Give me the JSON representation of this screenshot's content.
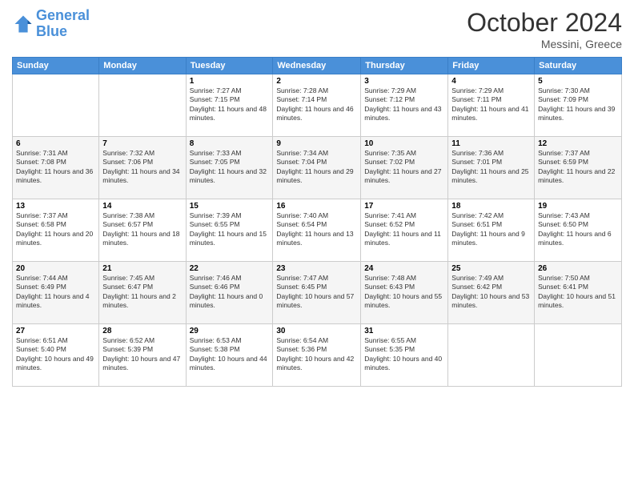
{
  "header": {
    "logo": {
      "line1": "General",
      "line2": "Blue"
    },
    "title": "October 2024",
    "location": "Messini, Greece"
  },
  "days_of_week": [
    "Sunday",
    "Monday",
    "Tuesday",
    "Wednesday",
    "Thursday",
    "Friday",
    "Saturday"
  ],
  "weeks": [
    [
      {
        "day": "",
        "info": ""
      },
      {
        "day": "",
        "info": ""
      },
      {
        "day": "1",
        "info": "Sunrise: 7:27 AM\nSunset: 7:15 PM\nDaylight: 11 hours and 48 minutes."
      },
      {
        "day": "2",
        "info": "Sunrise: 7:28 AM\nSunset: 7:14 PM\nDaylight: 11 hours and 46 minutes."
      },
      {
        "day": "3",
        "info": "Sunrise: 7:29 AM\nSunset: 7:12 PM\nDaylight: 11 hours and 43 minutes."
      },
      {
        "day": "4",
        "info": "Sunrise: 7:29 AM\nSunset: 7:11 PM\nDaylight: 11 hours and 41 minutes."
      },
      {
        "day": "5",
        "info": "Sunrise: 7:30 AM\nSunset: 7:09 PM\nDaylight: 11 hours and 39 minutes."
      }
    ],
    [
      {
        "day": "6",
        "info": "Sunrise: 7:31 AM\nSunset: 7:08 PM\nDaylight: 11 hours and 36 minutes."
      },
      {
        "day": "7",
        "info": "Sunrise: 7:32 AM\nSunset: 7:06 PM\nDaylight: 11 hours and 34 minutes."
      },
      {
        "day": "8",
        "info": "Sunrise: 7:33 AM\nSunset: 7:05 PM\nDaylight: 11 hours and 32 minutes."
      },
      {
        "day": "9",
        "info": "Sunrise: 7:34 AM\nSunset: 7:04 PM\nDaylight: 11 hours and 29 minutes."
      },
      {
        "day": "10",
        "info": "Sunrise: 7:35 AM\nSunset: 7:02 PM\nDaylight: 11 hours and 27 minutes."
      },
      {
        "day": "11",
        "info": "Sunrise: 7:36 AM\nSunset: 7:01 PM\nDaylight: 11 hours and 25 minutes."
      },
      {
        "day": "12",
        "info": "Sunrise: 7:37 AM\nSunset: 6:59 PM\nDaylight: 11 hours and 22 minutes."
      }
    ],
    [
      {
        "day": "13",
        "info": "Sunrise: 7:37 AM\nSunset: 6:58 PM\nDaylight: 11 hours and 20 minutes."
      },
      {
        "day": "14",
        "info": "Sunrise: 7:38 AM\nSunset: 6:57 PM\nDaylight: 11 hours and 18 minutes."
      },
      {
        "day": "15",
        "info": "Sunrise: 7:39 AM\nSunset: 6:55 PM\nDaylight: 11 hours and 15 minutes."
      },
      {
        "day": "16",
        "info": "Sunrise: 7:40 AM\nSunset: 6:54 PM\nDaylight: 11 hours and 13 minutes."
      },
      {
        "day": "17",
        "info": "Sunrise: 7:41 AM\nSunset: 6:52 PM\nDaylight: 11 hours and 11 minutes."
      },
      {
        "day": "18",
        "info": "Sunrise: 7:42 AM\nSunset: 6:51 PM\nDaylight: 11 hours and 9 minutes."
      },
      {
        "day": "19",
        "info": "Sunrise: 7:43 AM\nSunset: 6:50 PM\nDaylight: 11 hours and 6 minutes."
      }
    ],
    [
      {
        "day": "20",
        "info": "Sunrise: 7:44 AM\nSunset: 6:49 PM\nDaylight: 11 hours and 4 minutes."
      },
      {
        "day": "21",
        "info": "Sunrise: 7:45 AM\nSunset: 6:47 PM\nDaylight: 11 hours and 2 minutes."
      },
      {
        "day": "22",
        "info": "Sunrise: 7:46 AM\nSunset: 6:46 PM\nDaylight: 11 hours and 0 minutes."
      },
      {
        "day": "23",
        "info": "Sunrise: 7:47 AM\nSunset: 6:45 PM\nDaylight: 10 hours and 57 minutes."
      },
      {
        "day": "24",
        "info": "Sunrise: 7:48 AM\nSunset: 6:43 PM\nDaylight: 10 hours and 55 minutes."
      },
      {
        "day": "25",
        "info": "Sunrise: 7:49 AM\nSunset: 6:42 PM\nDaylight: 10 hours and 53 minutes."
      },
      {
        "day": "26",
        "info": "Sunrise: 7:50 AM\nSunset: 6:41 PM\nDaylight: 10 hours and 51 minutes."
      }
    ],
    [
      {
        "day": "27",
        "info": "Sunrise: 6:51 AM\nSunset: 5:40 PM\nDaylight: 10 hours and 49 minutes."
      },
      {
        "day": "28",
        "info": "Sunrise: 6:52 AM\nSunset: 5:39 PM\nDaylight: 10 hours and 47 minutes."
      },
      {
        "day": "29",
        "info": "Sunrise: 6:53 AM\nSunset: 5:38 PM\nDaylight: 10 hours and 44 minutes."
      },
      {
        "day": "30",
        "info": "Sunrise: 6:54 AM\nSunset: 5:36 PM\nDaylight: 10 hours and 42 minutes."
      },
      {
        "day": "31",
        "info": "Sunrise: 6:55 AM\nSunset: 5:35 PM\nDaylight: 10 hours and 40 minutes."
      },
      {
        "day": "",
        "info": ""
      },
      {
        "day": "",
        "info": ""
      }
    ]
  ]
}
